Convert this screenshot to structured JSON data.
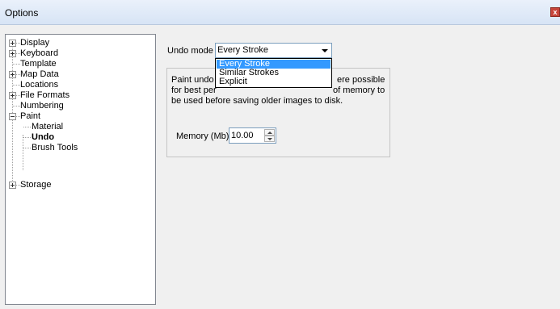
{
  "window": {
    "title": "Options",
    "close_glyph": "x"
  },
  "tree": {
    "items": [
      {
        "label": "Display",
        "expander": "plus"
      },
      {
        "label": "Keyboard",
        "expander": "plus"
      },
      {
        "label": "Template",
        "expander": "none"
      },
      {
        "label": "Map Data",
        "expander": "plus"
      },
      {
        "label": "Locations",
        "expander": "none"
      },
      {
        "label": "File Formats",
        "expander": "plus"
      },
      {
        "label": "Numbering",
        "expander": "none"
      },
      {
        "label": "Paint",
        "expander": "minus"
      },
      {
        "label": "Material",
        "expander": "none",
        "child": true
      },
      {
        "label": "Undo",
        "expander": "none",
        "child": true,
        "selected": true
      },
      {
        "label": "Brush Tools",
        "expander": "none",
        "child": true
      },
      {
        "label": "Storage",
        "expander": "plus"
      }
    ]
  },
  "undo": {
    "label": "Undo mode",
    "value": "Every Stroke",
    "options": [
      "Every Stroke",
      "Similar Strokes",
      "Explicit"
    ],
    "selected_index": 0
  },
  "description": {
    "line1_a": "Paint undo",
    "line1_b": "ere possible",
    "line2_a": "for best per",
    "line2_b": "of memory to",
    "line3": "be used before saving older images to disk."
  },
  "memory": {
    "label": "Memory (Mb)",
    "value": "10.00"
  }
}
